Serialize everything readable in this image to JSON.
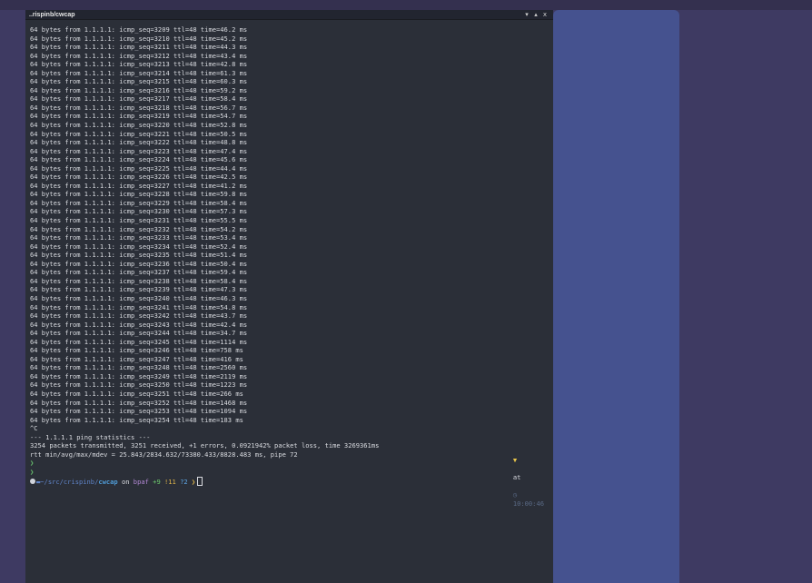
{
  "window": {
    "title": "..rispinb/cwcap",
    "controls": [
      "▾",
      "▴",
      "x"
    ]
  },
  "terminal": {
    "lines": [
      "64 bytes from 1.1.1.1: icmp_seq=3209 ttl=48 time=46.2 ms",
      "64 bytes from 1.1.1.1: icmp_seq=3210 ttl=48 time=45.2 ms",
      "64 bytes from 1.1.1.1: icmp_seq=3211 ttl=48 time=44.3 ms",
      "64 bytes from 1.1.1.1: icmp_seq=3212 ttl=48 time=43.4 ms",
      "64 bytes from 1.1.1.1: icmp_seq=3213 ttl=48 time=42.8 ms",
      "64 bytes from 1.1.1.1: icmp_seq=3214 ttl=48 time=61.3 ms",
      "64 bytes from 1.1.1.1: icmp_seq=3215 ttl=48 time=60.3 ms",
      "64 bytes from 1.1.1.1: icmp_seq=3216 ttl=48 time=59.2 ms",
      "64 bytes from 1.1.1.1: icmp_seq=3217 ttl=48 time=58.4 ms",
      "64 bytes from 1.1.1.1: icmp_seq=3218 ttl=48 time=56.7 ms",
      "64 bytes from 1.1.1.1: icmp_seq=3219 ttl=48 time=54.7 ms",
      "64 bytes from 1.1.1.1: icmp_seq=3220 ttl=48 time=52.8 ms",
      "64 bytes from 1.1.1.1: icmp_seq=3221 ttl=48 time=50.5 ms",
      "64 bytes from 1.1.1.1: icmp_seq=3222 ttl=48 time=48.8 ms",
      "64 bytes from 1.1.1.1: icmp_seq=3223 ttl=48 time=47.4 ms",
      "64 bytes from 1.1.1.1: icmp_seq=3224 ttl=48 time=45.6 ms",
      "64 bytes from 1.1.1.1: icmp_seq=3225 ttl=48 time=44.4 ms",
      "64 bytes from 1.1.1.1: icmp_seq=3226 ttl=48 time=42.5 ms",
      "64 bytes from 1.1.1.1: icmp_seq=3227 ttl=48 time=41.2 ms",
      "64 bytes from 1.1.1.1: icmp_seq=3228 ttl=48 time=59.8 ms",
      "64 bytes from 1.1.1.1: icmp_seq=3229 ttl=48 time=58.4 ms",
      "64 bytes from 1.1.1.1: icmp_seq=3230 ttl=48 time=57.3 ms",
      "64 bytes from 1.1.1.1: icmp_seq=3231 ttl=48 time=55.5 ms",
      "64 bytes from 1.1.1.1: icmp_seq=3232 ttl=48 time=54.2 ms",
      "64 bytes from 1.1.1.1: icmp_seq=3233 ttl=48 time=53.4 ms",
      "64 bytes from 1.1.1.1: icmp_seq=3234 ttl=48 time=52.4 ms",
      "64 bytes from 1.1.1.1: icmp_seq=3235 ttl=48 time=51.4 ms",
      "64 bytes from 1.1.1.1: icmp_seq=3236 ttl=48 time=50.4 ms",
      "64 bytes from 1.1.1.1: icmp_seq=3237 ttl=48 time=59.4 ms",
      "64 bytes from 1.1.1.1: icmp_seq=3238 ttl=48 time=58.4 ms",
      "64 bytes from 1.1.1.1: icmp_seq=3239 ttl=48 time=47.3 ms",
      "64 bytes from 1.1.1.1: icmp_seq=3240 ttl=48 time=46.3 ms",
      "64 bytes from 1.1.1.1: icmp_seq=3241 ttl=48 time=54.8 ms",
      "64 bytes from 1.1.1.1: icmp_seq=3242 ttl=48 time=43.7 ms",
      "64 bytes from 1.1.1.1: icmp_seq=3243 ttl=48 time=42.4 ms",
      "64 bytes from 1.1.1.1: icmp_seq=3244 ttl=48 time=34.7 ms",
      "64 bytes from 1.1.1.1: icmp_seq=3245 ttl=48 time=1114 ms",
      "64 bytes from 1.1.1.1: icmp_seq=3246 ttl=48 time=758 ms",
      "64 bytes from 1.1.1.1: icmp_seq=3247 ttl=48 time=416 ms",
      "64 bytes from 1.1.1.1: icmp_seq=3248 ttl=48 time=2560 ms",
      "64 bytes from 1.1.1.1: icmp_seq=3249 ttl=48 time=2119 ms",
      "64 bytes from 1.1.1.1: icmp_seq=3250 ttl=48 time=1223 ms",
      "64 bytes from 1.1.1.1: icmp_seq=3251 ttl=48 time=266 ms",
      "64 bytes from 1.1.1.1: icmp_seq=3252 ttl=48 time=1468 ms",
      "64 bytes from 1.1.1.1: icmp_seq=3253 ttl=48 time=1094 ms",
      "64 bytes from 1.1.1.1: icmp_seq=3254 ttl=48 time=183 ms",
      "^C",
      "--- 1.1.1.1 ping statistics ---",
      "3254 packets transmitted, 3251 received, +1 errors, 0.0921942% packet loss, time 3269361ms",
      "rtt min/avg/max/mdev = 25.843/2834.632/73380.433/8828.483 ms, pipe 72"
    ],
    "blank_prompt_glyphs": [
      "❯",
      "❯"
    ],
    "prompt": {
      "path_prefix": "~/src/crispinb/",
      "path_dir": "cwcap",
      "on_text": " on ",
      "git_icon": "",
      "branch_icon": "",
      "branch": "bpaf",
      "staged": "+9",
      "modified": "!11",
      "untracked": "?2",
      "arrow": "❯"
    },
    "status": {
      "indicator": "▼",
      "at_text": "at",
      "clock_icon": "◷",
      "time": "10:00:46"
    }
  },
  "colors": {
    "desktop": "#3e3a62",
    "terminal_bg": "#2b2f38",
    "side_panel": "#45528f",
    "text": "#d9dbe0",
    "accent_yellow": "#e8c54a",
    "accent_green": "#69c36f"
  }
}
